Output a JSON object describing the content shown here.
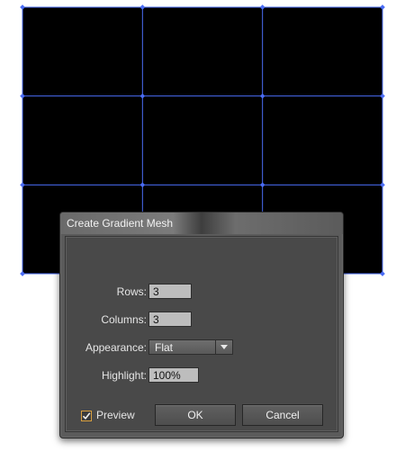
{
  "artboard": {
    "mesh_rows": 3,
    "mesh_columns": 3,
    "mesh_fill": "#000000",
    "mesh_line_color": "#4a6cf5"
  },
  "dialog": {
    "title": "Create Gradient Mesh",
    "rows_label": "Rows:",
    "rows_value": "3",
    "columns_label": "Columns:",
    "columns_value": "3",
    "appearance_label": "Appearance:",
    "appearance_value": "Flat",
    "highlight_label": "Highlight:",
    "highlight_value": "100%",
    "preview_label": "Preview",
    "preview_checked": true,
    "ok_label": "OK",
    "cancel_label": "Cancel",
    "accent_color": "#d9a040"
  }
}
